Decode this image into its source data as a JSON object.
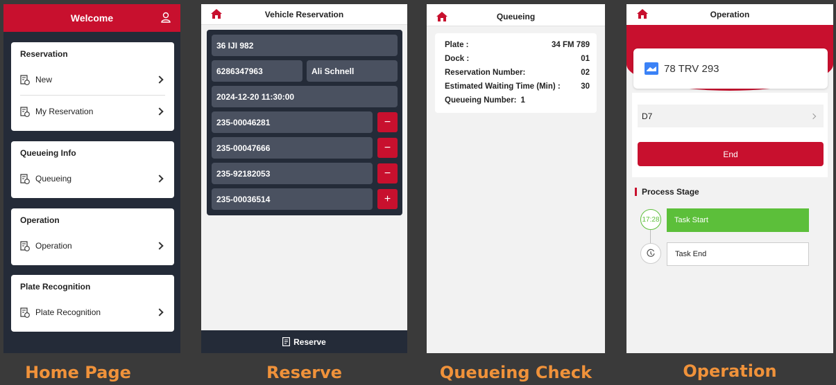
{
  "home": {
    "title": "Welcome",
    "cards": [
      {
        "title": "Reservation",
        "items": [
          "New",
          "My Reservation"
        ]
      },
      {
        "title": "Queueing Info",
        "items": [
          "Queueing"
        ]
      },
      {
        "title": "Operation",
        "items": [
          "Operation"
        ]
      },
      {
        "title": "Plate Recognition",
        "items": [
          "Plate Recognition"
        ]
      }
    ],
    "caption": "Home Page"
  },
  "reserve": {
    "title": "Vehicle Reservation",
    "plate": "36 IJI 982",
    "phone": "6286347963",
    "name": "Ali Schnell",
    "datetime": "2024-12-20 11:30:00",
    "orders": [
      {
        "value": "235-00046281",
        "action": "−"
      },
      {
        "value": "235-00047666",
        "action": "−"
      },
      {
        "value": "235-92182053",
        "action": "−"
      },
      {
        "value": "235-00036514",
        "action": "+"
      }
    ],
    "button": "Reserve",
    "caption": "Reserve"
  },
  "queue": {
    "title": "Queueing",
    "rows": [
      {
        "label": "Plate  :",
        "value": "34 FM 789"
      },
      {
        "label": "Dock  :",
        "value": "01"
      },
      {
        "label": "Reservation Number:",
        "value": "02"
      },
      {
        "label": "Estimated Waiting Time  (Min)  :",
        "value": "30"
      },
      {
        "label": "Queueing Number:",
        "value": "1"
      }
    ],
    "caption": "Queueing Check"
  },
  "operation": {
    "title": "Operation",
    "plate": "78 TRV 293",
    "dock": "D7",
    "end_button": "End",
    "stage_title": "Process Stage",
    "stages": [
      {
        "time": "17:28",
        "label": "Task Start",
        "status": "done"
      },
      {
        "time": "",
        "label": "Task End",
        "status": "pending"
      }
    ],
    "caption": "Operation"
  },
  "colors": {
    "brand_red": "#c8102e",
    "dark_navy": "#242b38",
    "success_green": "#5cbf3a",
    "caption_orange": "#f0923a"
  }
}
